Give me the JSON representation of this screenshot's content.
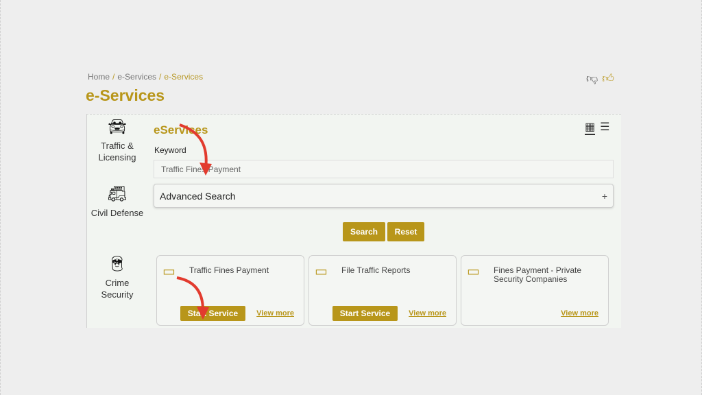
{
  "breadcrumb": {
    "home": "Home",
    "sep": "/",
    "parent": "e-Services",
    "current": "e-Services"
  },
  "page": {
    "title": "e-Services"
  },
  "sidebar": {
    "items": [
      {
        "label_line1": "Traffic &",
        "label_line2": "Licensing",
        "icon": "car-icon"
      },
      {
        "label_line1": "Civil Defense",
        "label_line2": "",
        "icon": "fire-truck-icon"
      },
      {
        "label_line1": "Crime",
        "label_line2": "Security",
        "icon": "officer-icon"
      }
    ]
  },
  "main": {
    "title": "eServices",
    "keyword_label": "Keyword",
    "keyword_value": "Traffic Fines Payment",
    "advanced_search_label": "Advanced Search",
    "advanced_search_toggle": "+",
    "search_label": "Search",
    "reset_label": "Reset"
  },
  "cards": [
    {
      "title": "Traffic Fines Payment",
      "start_label": "Start Service",
      "more_label": "View more"
    },
    {
      "title": "File Traffic Reports",
      "start_label": "Start Service",
      "more_label": "View more"
    },
    {
      "title": "Fines Payment - Private Security Companies",
      "start_label": "",
      "more_label": "View more"
    }
  ],
  "colors": {
    "accent": "#b8961a",
    "annotation_arrow": "#e23b2e"
  }
}
